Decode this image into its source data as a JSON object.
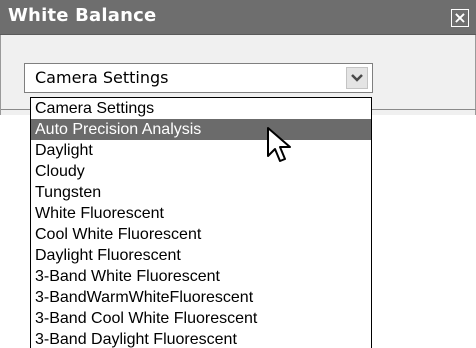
{
  "dialog": {
    "title": "White Balance",
    "close_glyph": "×"
  },
  "combo": {
    "value": "Camera Settings"
  },
  "dropdown": {
    "options": [
      "Camera Settings",
      "Auto Precision Analysis",
      "Daylight",
      "Cloudy",
      "Tungsten",
      "White Fluorescent",
      "Cool White Fluorescent",
      "Daylight Fluorescent",
      "3-Band White Fluorescent",
      "3-BandWarmWhiteFluorescent",
      "3-Band Cool White Fluorescent",
      "3-Band Daylight Fluorescent"
    ],
    "highlighted_index": 1
  },
  "colors": {
    "titlebar": "#6e6e6e",
    "highlight": "#6b6b6b"
  },
  "icons": {
    "close": "close-icon",
    "dropdown_arrow": "chevron-down-icon",
    "cursor": "mouse-pointer-icon"
  }
}
